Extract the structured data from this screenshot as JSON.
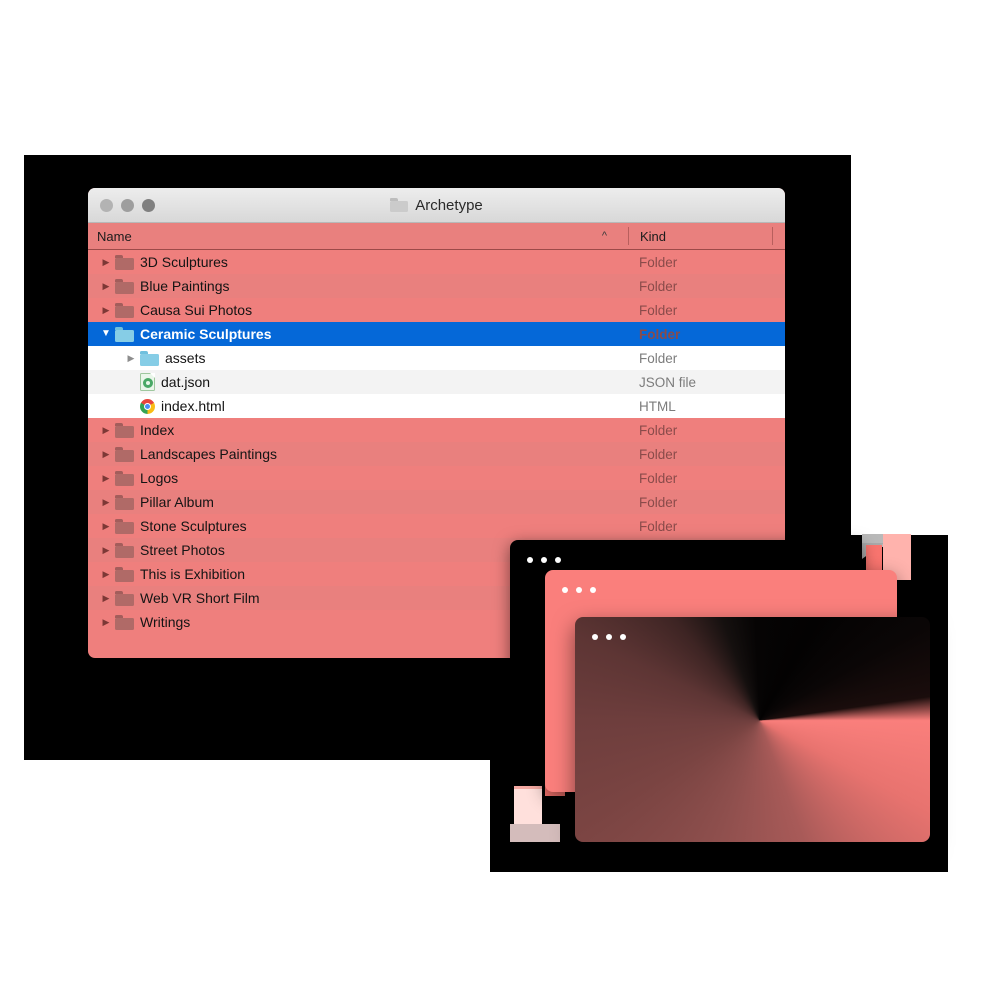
{
  "window": {
    "title": "Archetype",
    "title_icon": "folder-icon",
    "traffic_lights": [
      "close-button",
      "minimize-button",
      "zoom-button"
    ]
  },
  "columns": {
    "name": "Name",
    "kind": "Kind",
    "sort_indicator": "^"
  },
  "rows": [
    {
      "name": "3D Sculptures",
      "kind": "Folder",
      "depth": 0,
      "twisty": "▶",
      "icon": "folder-icon-tinted",
      "state": "collapsed"
    },
    {
      "name": "Blue Paintings",
      "kind": "Folder",
      "depth": 0,
      "twisty": "▶",
      "icon": "folder-icon-tinted",
      "state": "collapsed"
    },
    {
      "name": "Causa Sui Photos",
      "kind": "Folder",
      "depth": 0,
      "twisty": "▶",
      "icon": "folder-icon-tinted",
      "state": "collapsed"
    },
    {
      "name": "Ceramic Sculptures",
      "kind": "Folder",
      "depth": 0,
      "twisty": "▼",
      "icon": "folder-icon-blue",
      "state": "expanded",
      "selected": true
    },
    {
      "name": "assets",
      "kind": "Folder",
      "depth": 1,
      "twisty": "▶",
      "icon": "folder-icon-blue",
      "state": "collapsed",
      "child": true
    },
    {
      "name": "dat.json",
      "kind": "JSON file",
      "depth": 1,
      "twisty": "",
      "icon": "json-file-icon",
      "state": "leaf",
      "child": true
    },
    {
      "name": "index.html",
      "kind": "HTML",
      "depth": 1,
      "twisty": "",
      "icon": "chrome-file-icon",
      "state": "leaf",
      "child": true
    },
    {
      "name": "Index",
      "kind": "Folder",
      "depth": 0,
      "twisty": "▶",
      "icon": "folder-icon-tinted",
      "state": "collapsed"
    },
    {
      "name": "Landscapes Paintings",
      "kind": "Folder",
      "depth": 0,
      "twisty": "▶",
      "icon": "folder-icon-tinted",
      "state": "collapsed"
    },
    {
      "name": "Logos",
      "kind": "Folder",
      "depth": 0,
      "twisty": "▶",
      "icon": "folder-icon-tinted",
      "state": "collapsed"
    },
    {
      "name": "Pillar Album",
      "kind": "Folder",
      "depth": 0,
      "twisty": "▶",
      "icon": "folder-icon-tinted",
      "state": "collapsed"
    },
    {
      "name": "Stone Sculptures",
      "kind": "Folder",
      "depth": 0,
      "twisty": "▶",
      "icon": "folder-icon-tinted",
      "state": "collapsed"
    },
    {
      "name": "Street Photos",
      "kind": "",
      "depth": 0,
      "twisty": "▶",
      "icon": "folder-icon-tinted",
      "state": "collapsed"
    },
    {
      "name": "This is Exhibition",
      "kind": "",
      "depth": 0,
      "twisty": "▶",
      "icon": "folder-icon-tinted",
      "state": "collapsed"
    },
    {
      "name": "Web VR Short Film",
      "kind": "",
      "depth": 0,
      "twisty": "▶",
      "icon": "folder-icon-tinted",
      "state": "collapsed"
    },
    {
      "name": "Writings",
      "kind": "",
      "depth": 0,
      "twisty": "▶",
      "icon": "folder-icon-tinted",
      "state": "collapsed"
    }
  ],
  "stack": {
    "windows": [
      {
        "name": "back-window",
        "style": "black"
      },
      {
        "name": "mid-window",
        "style": "salmon"
      },
      {
        "name": "front-window",
        "style": "conic-gradient"
      }
    ],
    "dot_count": 3
  },
  "colors": {
    "selection_blue": "#0568d8",
    "row_pink": "#ef7f7d",
    "row_pink_alt": "#e9807e",
    "salmon": "#fa7f7c",
    "maroon": "#6e3e3d",
    "black": "#000000",
    "titlebar_gray": "#e2e2e2"
  }
}
